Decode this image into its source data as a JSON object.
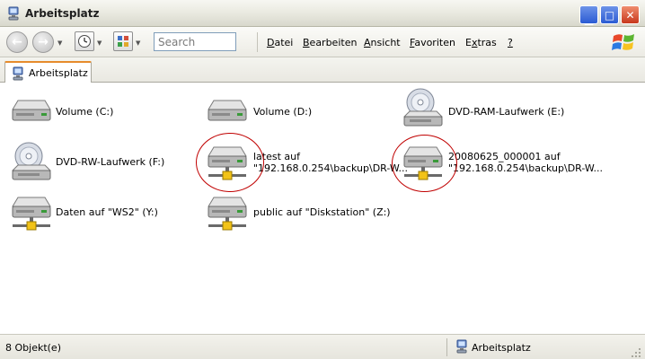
{
  "window": {
    "title": "Arbeitsplatz"
  },
  "toolbar": {
    "search_placeholder": "Search",
    "menu": [
      {
        "pre": "",
        "key": "D",
        "post": "atei"
      },
      {
        "pre": "",
        "key": "B",
        "post": "earbeiten"
      },
      {
        "pre": "",
        "key": "A",
        "post": "nsicht"
      },
      {
        "pre": "",
        "key": "F",
        "post": "avoriten"
      },
      {
        "pre": "E",
        "key": "x",
        "post": "tras"
      },
      {
        "pre": "",
        "key": "?",
        "post": ""
      }
    ]
  },
  "tab": {
    "label": "Arbeitsplatz"
  },
  "items": [
    {
      "icon": "hard-drive-icon",
      "line1": "Volume (C:)",
      "line2": ""
    },
    {
      "icon": "hard-drive-icon",
      "line1": "Volume (D:)",
      "line2": ""
    },
    {
      "icon": "dvd-drive-icon",
      "line1": "DVD-RAM-Laufwerk (E:)",
      "line2": ""
    },
    {
      "icon": "dvd-drive-icon",
      "line1": "DVD-RW-Laufwerk (F:)",
      "line2": ""
    },
    {
      "icon": "network-drive-icon",
      "line1": "latest auf",
      "line2": "\"192.168.0.254\\backup\\DR-W..."
    },
    {
      "icon": "network-drive-icon",
      "line1": "20080625_000001 auf",
      "line2": "\"192.168.0.254\\backup\\DR-W..."
    },
    {
      "icon": "network-drive-icon",
      "line1": "Daten auf \"WS2\" (Y:)",
      "line2": ""
    },
    {
      "icon": "network-drive-icon",
      "line1": "public auf \"Diskstation\" (Z:)",
      "line2": ""
    }
  ],
  "statusbar": {
    "count": "8 Objekt(e)",
    "location": "Arbeitsplatz"
  },
  "colors": {
    "annotation_circle": "#c00000",
    "tab_accent": "#e68b2c",
    "close_button": "#c8381c"
  }
}
